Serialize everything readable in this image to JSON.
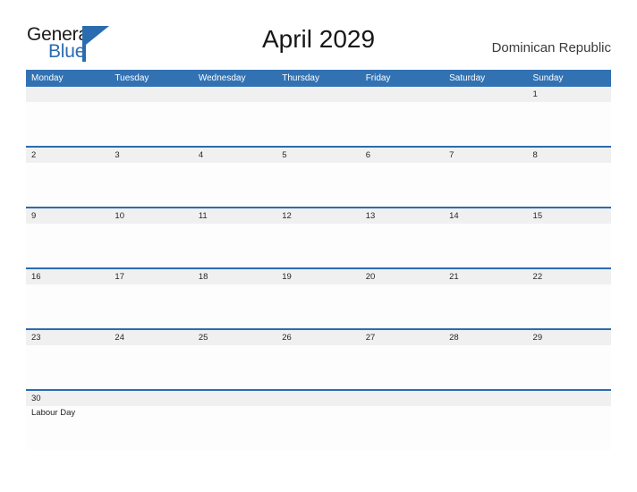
{
  "brand": {
    "name_part1": "General",
    "name_part2": "Blue",
    "mark_icon": "triangle-flag-icon",
    "color_primary": "#2b6cb0",
    "color_dark": "#1a1a1a"
  },
  "header": {
    "title": "April 2029",
    "country": "Dominican Republic"
  },
  "calendar": {
    "header_bg": "#3272b3",
    "date_strip_bg": "#f0f0f0",
    "row_divider": "#2b6cb0",
    "weekdays": [
      "Monday",
      "Tuesday",
      "Wednesday",
      "Thursday",
      "Friday",
      "Saturday",
      "Sunday"
    ],
    "weeks": [
      {
        "days": [
          {
            "date": "",
            "events": []
          },
          {
            "date": "",
            "events": []
          },
          {
            "date": "",
            "events": []
          },
          {
            "date": "",
            "events": []
          },
          {
            "date": "",
            "events": []
          },
          {
            "date": "",
            "events": []
          },
          {
            "date": "1",
            "events": []
          }
        ]
      },
      {
        "days": [
          {
            "date": "2",
            "events": []
          },
          {
            "date": "3",
            "events": []
          },
          {
            "date": "4",
            "events": []
          },
          {
            "date": "5",
            "events": []
          },
          {
            "date": "6",
            "events": []
          },
          {
            "date": "7",
            "events": []
          },
          {
            "date": "8",
            "events": []
          }
        ]
      },
      {
        "days": [
          {
            "date": "9",
            "events": []
          },
          {
            "date": "10",
            "events": []
          },
          {
            "date": "11",
            "events": []
          },
          {
            "date": "12",
            "events": []
          },
          {
            "date": "13",
            "events": []
          },
          {
            "date": "14",
            "events": []
          },
          {
            "date": "15",
            "events": []
          }
        ]
      },
      {
        "days": [
          {
            "date": "16",
            "events": []
          },
          {
            "date": "17",
            "events": []
          },
          {
            "date": "18",
            "events": []
          },
          {
            "date": "19",
            "events": []
          },
          {
            "date": "20",
            "events": []
          },
          {
            "date": "21",
            "events": []
          },
          {
            "date": "22",
            "events": []
          }
        ]
      },
      {
        "days": [
          {
            "date": "23",
            "events": []
          },
          {
            "date": "24",
            "events": []
          },
          {
            "date": "25",
            "events": []
          },
          {
            "date": "26",
            "events": []
          },
          {
            "date": "27",
            "events": []
          },
          {
            "date": "28",
            "events": []
          },
          {
            "date": "29",
            "events": []
          }
        ]
      },
      {
        "days": [
          {
            "date": "30",
            "events": [
              "Labour Day"
            ]
          },
          {
            "date": "",
            "events": []
          },
          {
            "date": "",
            "events": []
          },
          {
            "date": "",
            "events": []
          },
          {
            "date": "",
            "events": []
          },
          {
            "date": "",
            "events": []
          },
          {
            "date": "",
            "events": []
          }
        ]
      }
    ]
  }
}
